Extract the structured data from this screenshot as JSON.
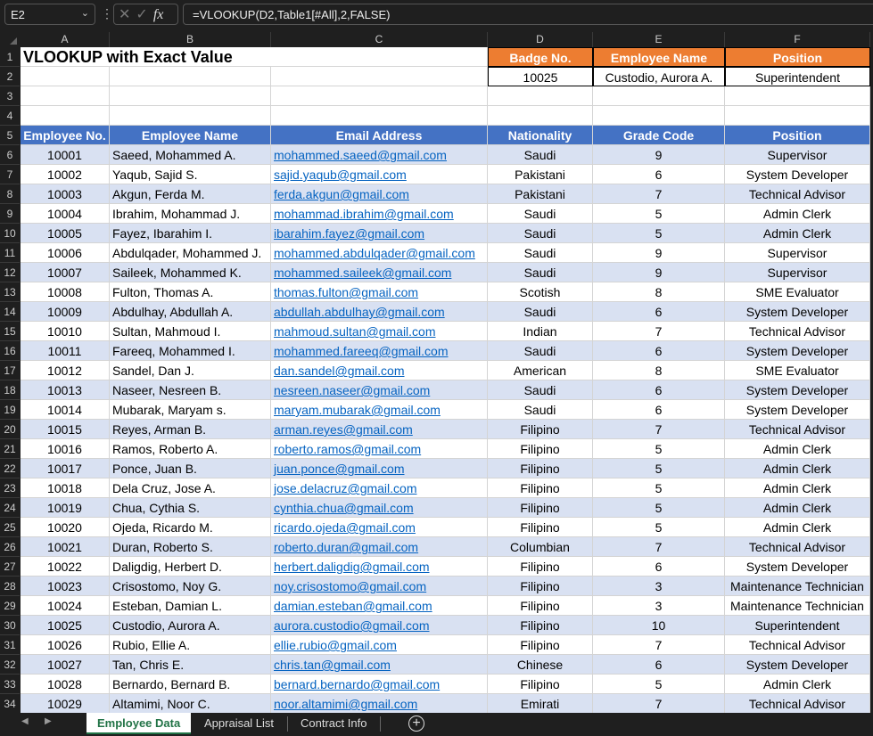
{
  "formula_bar": {
    "name_box": "E2",
    "formula": "=VLOOKUP(D2,Table1[#All],2,FALSE)"
  },
  "columns": [
    "A",
    "B",
    "C",
    "D",
    "E",
    "F"
  ],
  "title": "VLOOKUP with Exact Value",
  "lookup": {
    "headers": [
      "Badge No.",
      "Employee Name",
      "Position"
    ],
    "values": [
      "10025",
      "Custodio, Aurora A.",
      "Superintendent"
    ]
  },
  "table": {
    "headers": [
      "Employee No.",
      "Employee Name",
      "Email Address",
      "Nationality",
      "Grade Code",
      "Position"
    ],
    "rows": [
      [
        "10001",
        "Saeed, Mohammed A.",
        "mohammed.saeed@gmail.com",
        "Saudi",
        "9",
        "Supervisor"
      ],
      [
        "10002",
        "Yaqub, Sajid S.",
        "sajid.yaqub@gmail.com",
        "Pakistani",
        "6",
        "System Developer"
      ],
      [
        "10003",
        "Akgun, Ferda M.",
        "ferda.akgun@gmail.com",
        "Pakistani",
        "7",
        "Technical Advisor"
      ],
      [
        "10004",
        "Ibrahim, Mohammad J.",
        "mohammad.ibrahim@gmail.com",
        "Saudi",
        "5",
        "Admin Clerk"
      ],
      [
        "10005",
        "Fayez, Ibarahim I.",
        "ibarahim.fayez@gmail.com",
        "Saudi",
        "5",
        "Admin Clerk"
      ],
      [
        "10006",
        "Abdulqader, Mohammed J.",
        "mohammed.abdulqader@gmail.com",
        "Saudi",
        "9",
        "Supervisor"
      ],
      [
        "10007",
        "Saileek, Mohammed K.",
        "mohammed.saileek@gmail.com",
        "Saudi",
        "9",
        "Supervisor"
      ],
      [
        "10008",
        "Fulton, Thomas A.",
        "thomas.fulton@gmail.com",
        "Scotish",
        "8",
        "SME  Evaluator"
      ],
      [
        "10009",
        "Abdulhay, Abdullah A.",
        "abdullah.abdulhay@gmail.com",
        "Saudi",
        "6",
        "System Developer"
      ],
      [
        "10010",
        "Sultan, Mahmoud I.",
        "mahmoud.sultan@gmail.com",
        "Indian",
        "7",
        "Technical Advisor"
      ],
      [
        "10011",
        "Fareeq, Mohammed I.",
        "mohammed.fareeq@gmail.com",
        "Saudi",
        "6",
        "System Developer"
      ],
      [
        "10012",
        "Sandel, Dan J.",
        "dan.sandel@gmail.com",
        "American",
        "8",
        "SME  Evaluator"
      ],
      [
        "10013",
        "Naseer, Nesreen B.",
        "nesreen.naseer@gmail.com",
        "Saudi",
        "6",
        "System Developer"
      ],
      [
        "10014",
        "Mubarak, Maryam s.",
        "maryam.mubarak@gmail.com",
        "Saudi",
        "6",
        "System Developer"
      ],
      [
        "10015",
        "Reyes, Arman B.",
        "arman.reyes@gmail.com",
        "Filipino",
        "7",
        "Technical Advisor"
      ],
      [
        "10016",
        "Ramos, Roberto A.",
        "roberto.ramos@gmail.com",
        "Filipino",
        "5",
        "Admin Clerk"
      ],
      [
        "10017",
        "Ponce, Juan B.",
        "juan.ponce@gmail.com",
        "Filipino",
        "5",
        "Admin Clerk"
      ],
      [
        "10018",
        "Dela Cruz, Jose A.",
        "jose.delacruz@gmail.com",
        "Filipino",
        "5",
        "Admin Clerk"
      ],
      [
        "10019",
        "Chua, Cythia S.",
        "cynthia.chua@gmail.com",
        "Filipino",
        "5",
        "Admin Clerk"
      ],
      [
        "10020",
        "Ojeda, Ricardo M.",
        "ricardo.ojeda@gmail.com",
        "Filipino",
        "5",
        "Admin Clerk"
      ],
      [
        "10021",
        "Duran, Roberto S.",
        "roberto.duran@gmail.com",
        "Columbian",
        "7",
        "Technical Advisor"
      ],
      [
        "10022",
        "Daligdig, Herbert D.",
        "herbert.daligdig@gmail.com",
        "Filipino",
        "6",
        "System Developer"
      ],
      [
        "10023",
        "Crisostomo, Noy G.",
        "noy.crisostomo@gmail.com",
        "Filipino",
        "3",
        "Maintenance Technician"
      ],
      [
        "10024",
        "Esteban, Damian L.",
        "damian.esteban@gmail.com",
        "Filipino",
        "3",
        "Maintenance Technician"
      ],
      [
        "10025",
        "Custodio, Aurora A.",
        "aurora.custodio@gmail.com",
        "Filipino",
        "10",
        "Superintendent"
      ],
      [
        "10026",
        "Rubio, Ellie A.",
        "ellie.rubio@gmail.com",
        "Filipino",
        "7",
        "Technical Advisor"
      ],
      [
        "10027",
        "Tan, Chris E.",
        "chris.tan@gmail.com",
        "Chinese",
        "6",
        "System Developer"
      ],
      [
        "10028",
        "Bernardo, Bernard B.",
        "bernard.bernardo@gmail.com",
        "Filipino",
        "5",
        "Admin Clerk"
      ],
      [
        "10029",
        "Altamimi, Noor C.",
        "noor.altamimi@gmail.com",
        "Emirati",
        "7",
        "Technical Advisor"
      ]
    ]
  },
  "sheet_tabs": [
    "Employee Data",
    "Appraisal List",
    "Contract Info"
  ],
  "active_tab": "Employee Data"
}
